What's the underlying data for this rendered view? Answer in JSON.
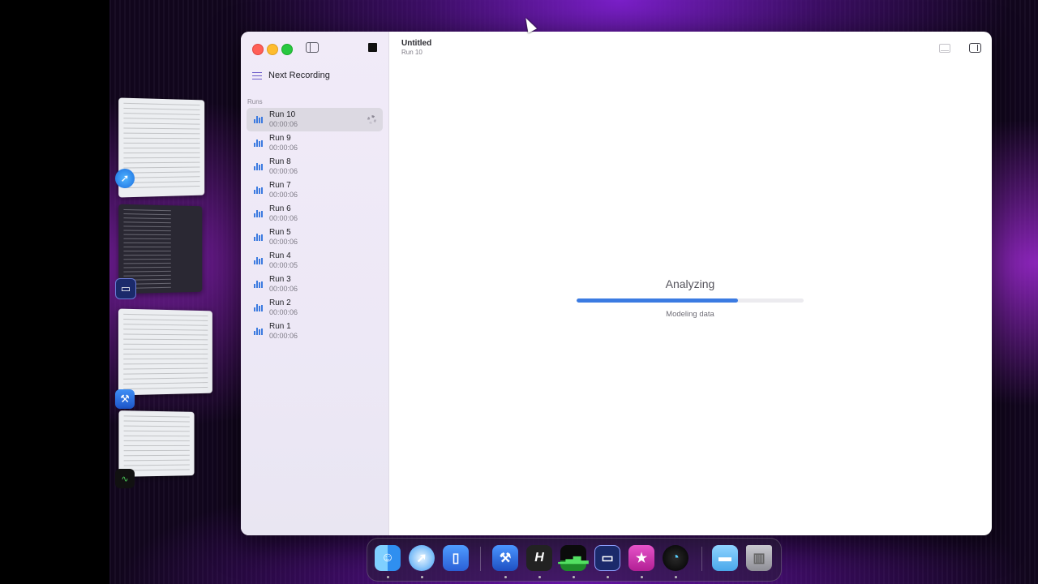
{
  "window": {
    "title": "Untitled",
    "subtitle": "Run 10"
  },
  "sidebar": {
    "next_recording_label": "Next Recording",
    "section_label": "Runs",
    "runs": [
      {
        "name": "Run 10",
        "time": "00:00:06",
        "selected": true,
        "in_progress": true
      },
      {
        "name": "Run 9",
        "time": "00:00:06"
      },
      {
        "name": "Run 8",
        "time": "00:00:06"
      },
      {
        "name": "Run 7",
        "time": "00:00:06"
      },
      {
        "name": "Run 6",
        "time": "00:00:06"
      },
      {
        "name": "Run 5",
        "time": "00:00:06"
      },
      {
        "name": "Run 4",
        "time": "00:00:05"
      },
      {
        "name": "Run 3",
        "time": "00:00:06"
      },
      {
        "name": "Run 2",
        "time": "00:00:06"
      },
      {
        "name": "Run 1",
        "time": "00:00:06"
      }
    ]
  },
  "main": {
    "status_title": "Analyzing",
    "status_detail": "Modeling data",
    "progress_fraction": 0.71
  },
  "stage_manager": [
    {
      "app": "safari-icon"
    },
    {
      "app": "terminal-icon"
    },
    {
      "app": "xcode-icon"
    },
    {
      "app": "activity-monitor-icon"
    }
  ],
  "dock": {
    "items": [
      {
        "icon": "finder-icon"
      },
      {
        "icon": "safari-icon"
      },
      {
        "icon": "simulator-icon"
      },
      {
        "icon": "xcode-beta-icon"
      },
      {
        "icon": "hammer-app-icon"
      },
      {
        "icon": "activity-monitor-icon"
      },
      {
        "icon": "terminal-app-icon"
      },
      {
        "icon": "instruments-star-icon"
      },
      {
        "icon": "speedometer-beta-icon"
      },
      {
        "icon": "downloads-folder-icon"
      },
      {
        "icon": "trash-icon"
      }
    ]
  },
  "colors": {
    "accent": "#3b7be2",
    "close": "#ff5f57",
    "minimize": "#febc2e",
    "maximize": "#28c840"
  }
}
